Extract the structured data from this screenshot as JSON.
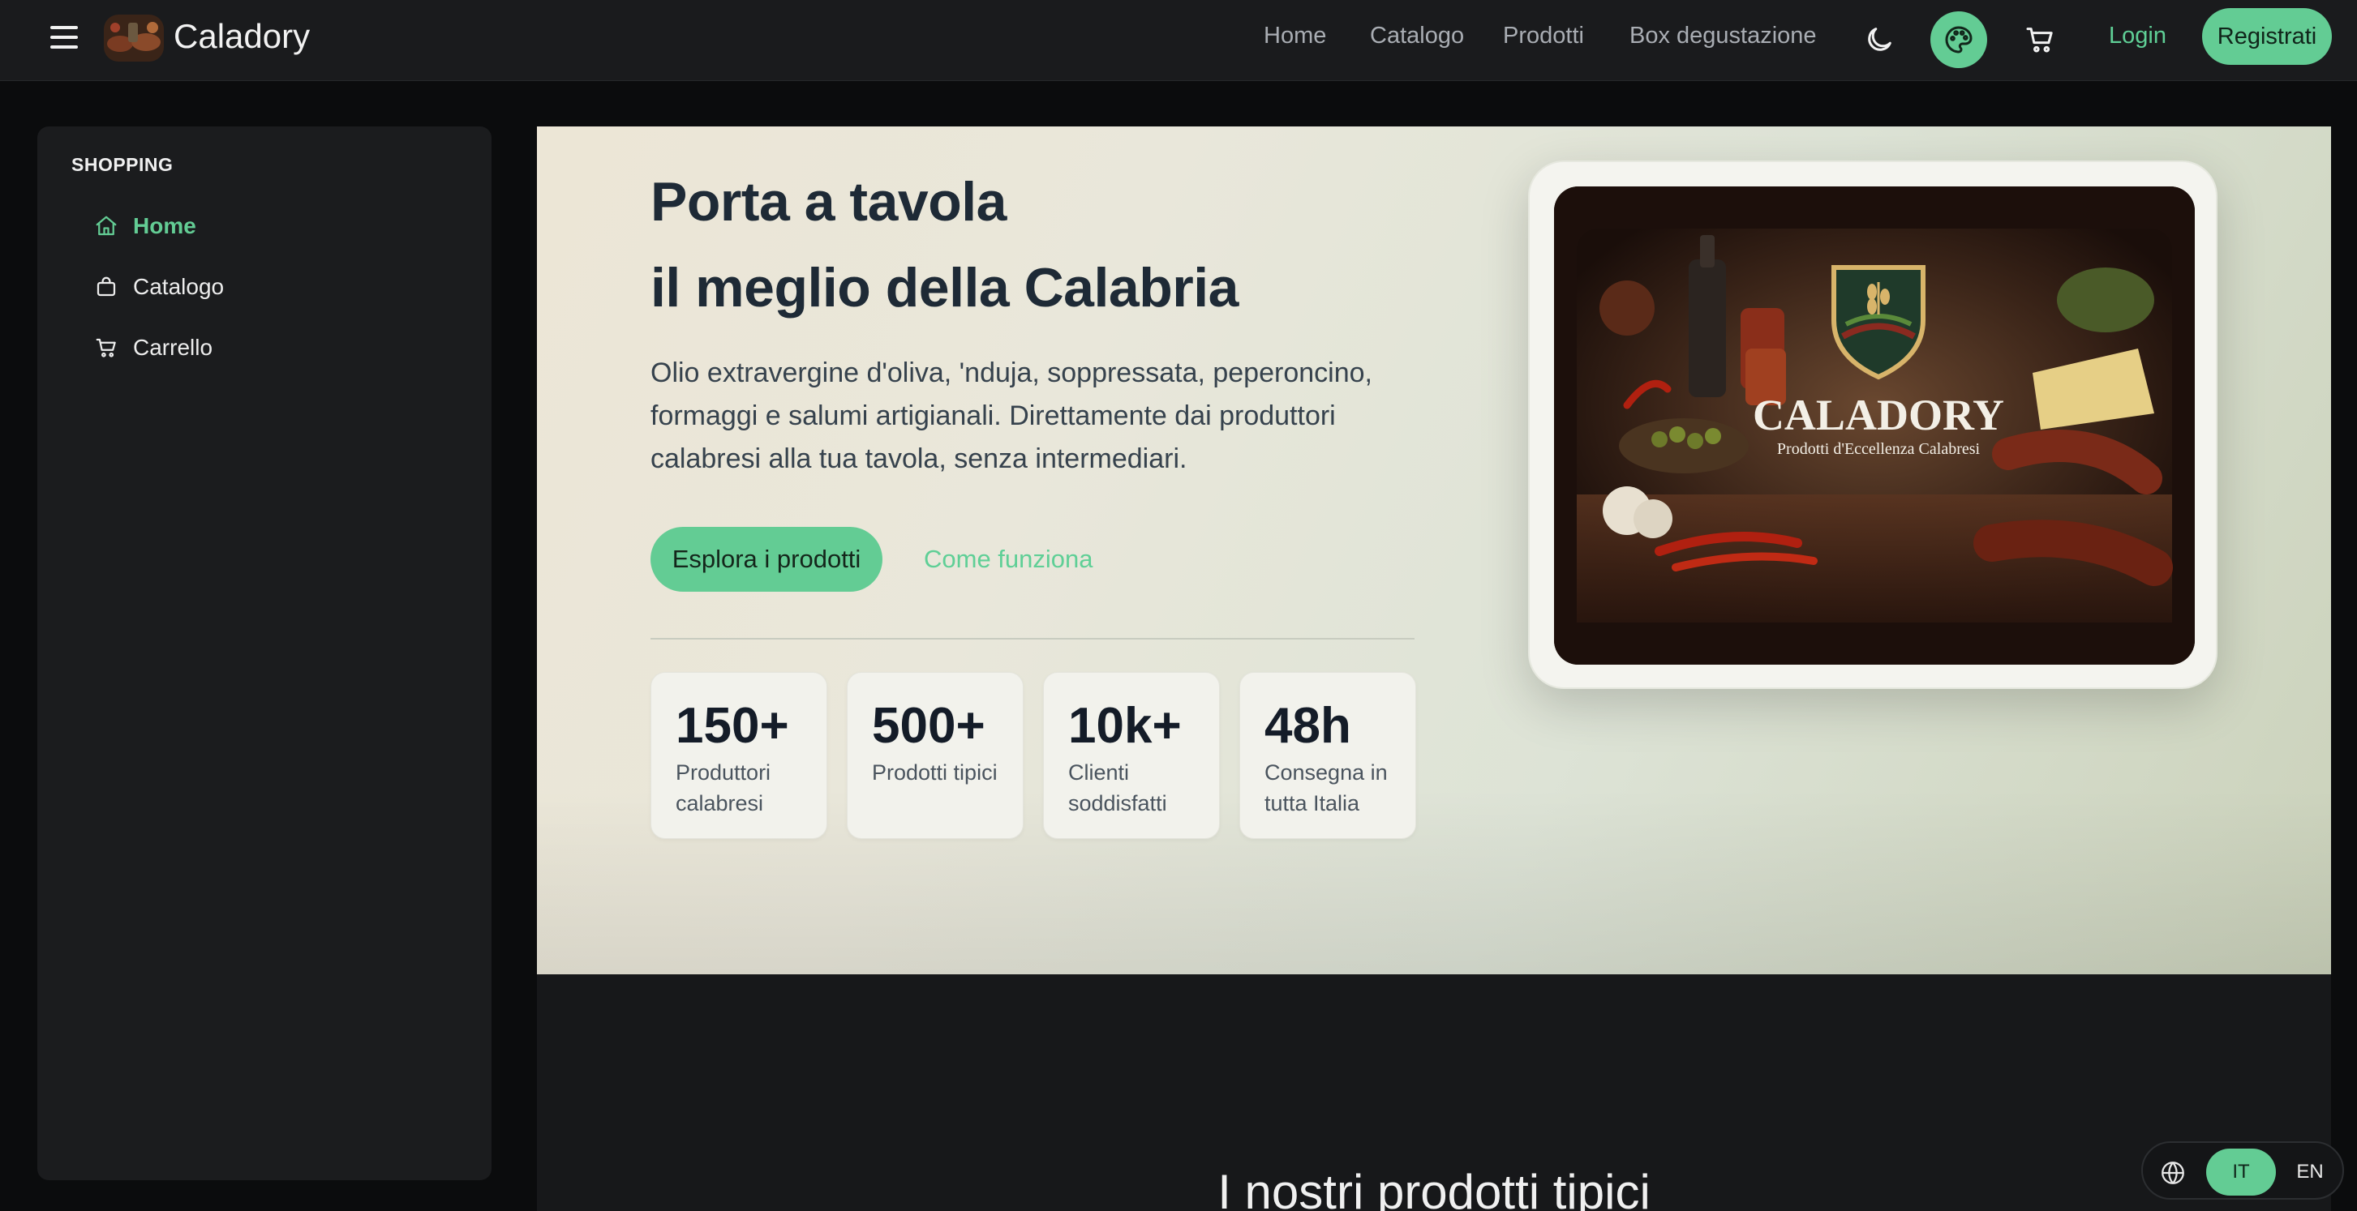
{
  "header": {
    "brand": "Caladory",
    "nav": [
      "Home",
      "Catalogo",
      "Prodotti",
      "Box degustazione"
    ],
    "login_label": "Login",
    "register_label": "Registrati",
    "icons": [
      "menu-icon",
      "moon-icon",
      "palette-icon",
      "cart-icon"
    ]
  },
  "sidebar": {
    "section_title": "SHOPPING",
    "items": [
      {
        "label": "Home",
        "icon": "home-icon",
        "active": true
      },
      {
        "label": "Catalogo",
        "icon": "bag-icon",
        "active": false
      },
      {
        "label": "Carrello",
        "icon": "cart-icon",
        "active": false
      }
    ]
  },
  "hero": {
    "title_line1": "Porta a tavola",
    "title_line2": "il meglio della Calabria",
    "description": "Olio extravergine d'oliva, 'nduja, soppressata, peperoncino, formaggi e salumi artigianali. Direttamente dai produttori calabresi alla tua tavola, senza intermediari.",
    "primary_cta": "Esplora i prodotti",
    "secondary_cta": "Come funziona",
    "stats": [
      {
        "value": "150+",
        "label": "Produttori calabresi"
      },
      {
        "value": "500+",
        "label": "Prodotti tipici"
      },
      {
        "value": "10k+",
        "label": "Clienti soddisfatti"
      },
      {
        "value": "48h",
        "label": "Consegna in tutta Italia"
      }
    ],
    "image": {
      "logo_text": "CALADORY",
      "logo_subtitle": "Prodotti d'Eccellenza Calabresi"
    }
  },
  "section2": {
    "title": "I nostri prodotti tipici"
  },
  "language": {
    "options": [
      "IT",
      "EN"
    ],
    "selected": "IT"
  },
  "colors": {
    "accent": "#63cc94",
    "topbar": "#1a1b1d",
    "background": "#0b0c0d",
    "hero_text": "#1e2a36"
  }
}
